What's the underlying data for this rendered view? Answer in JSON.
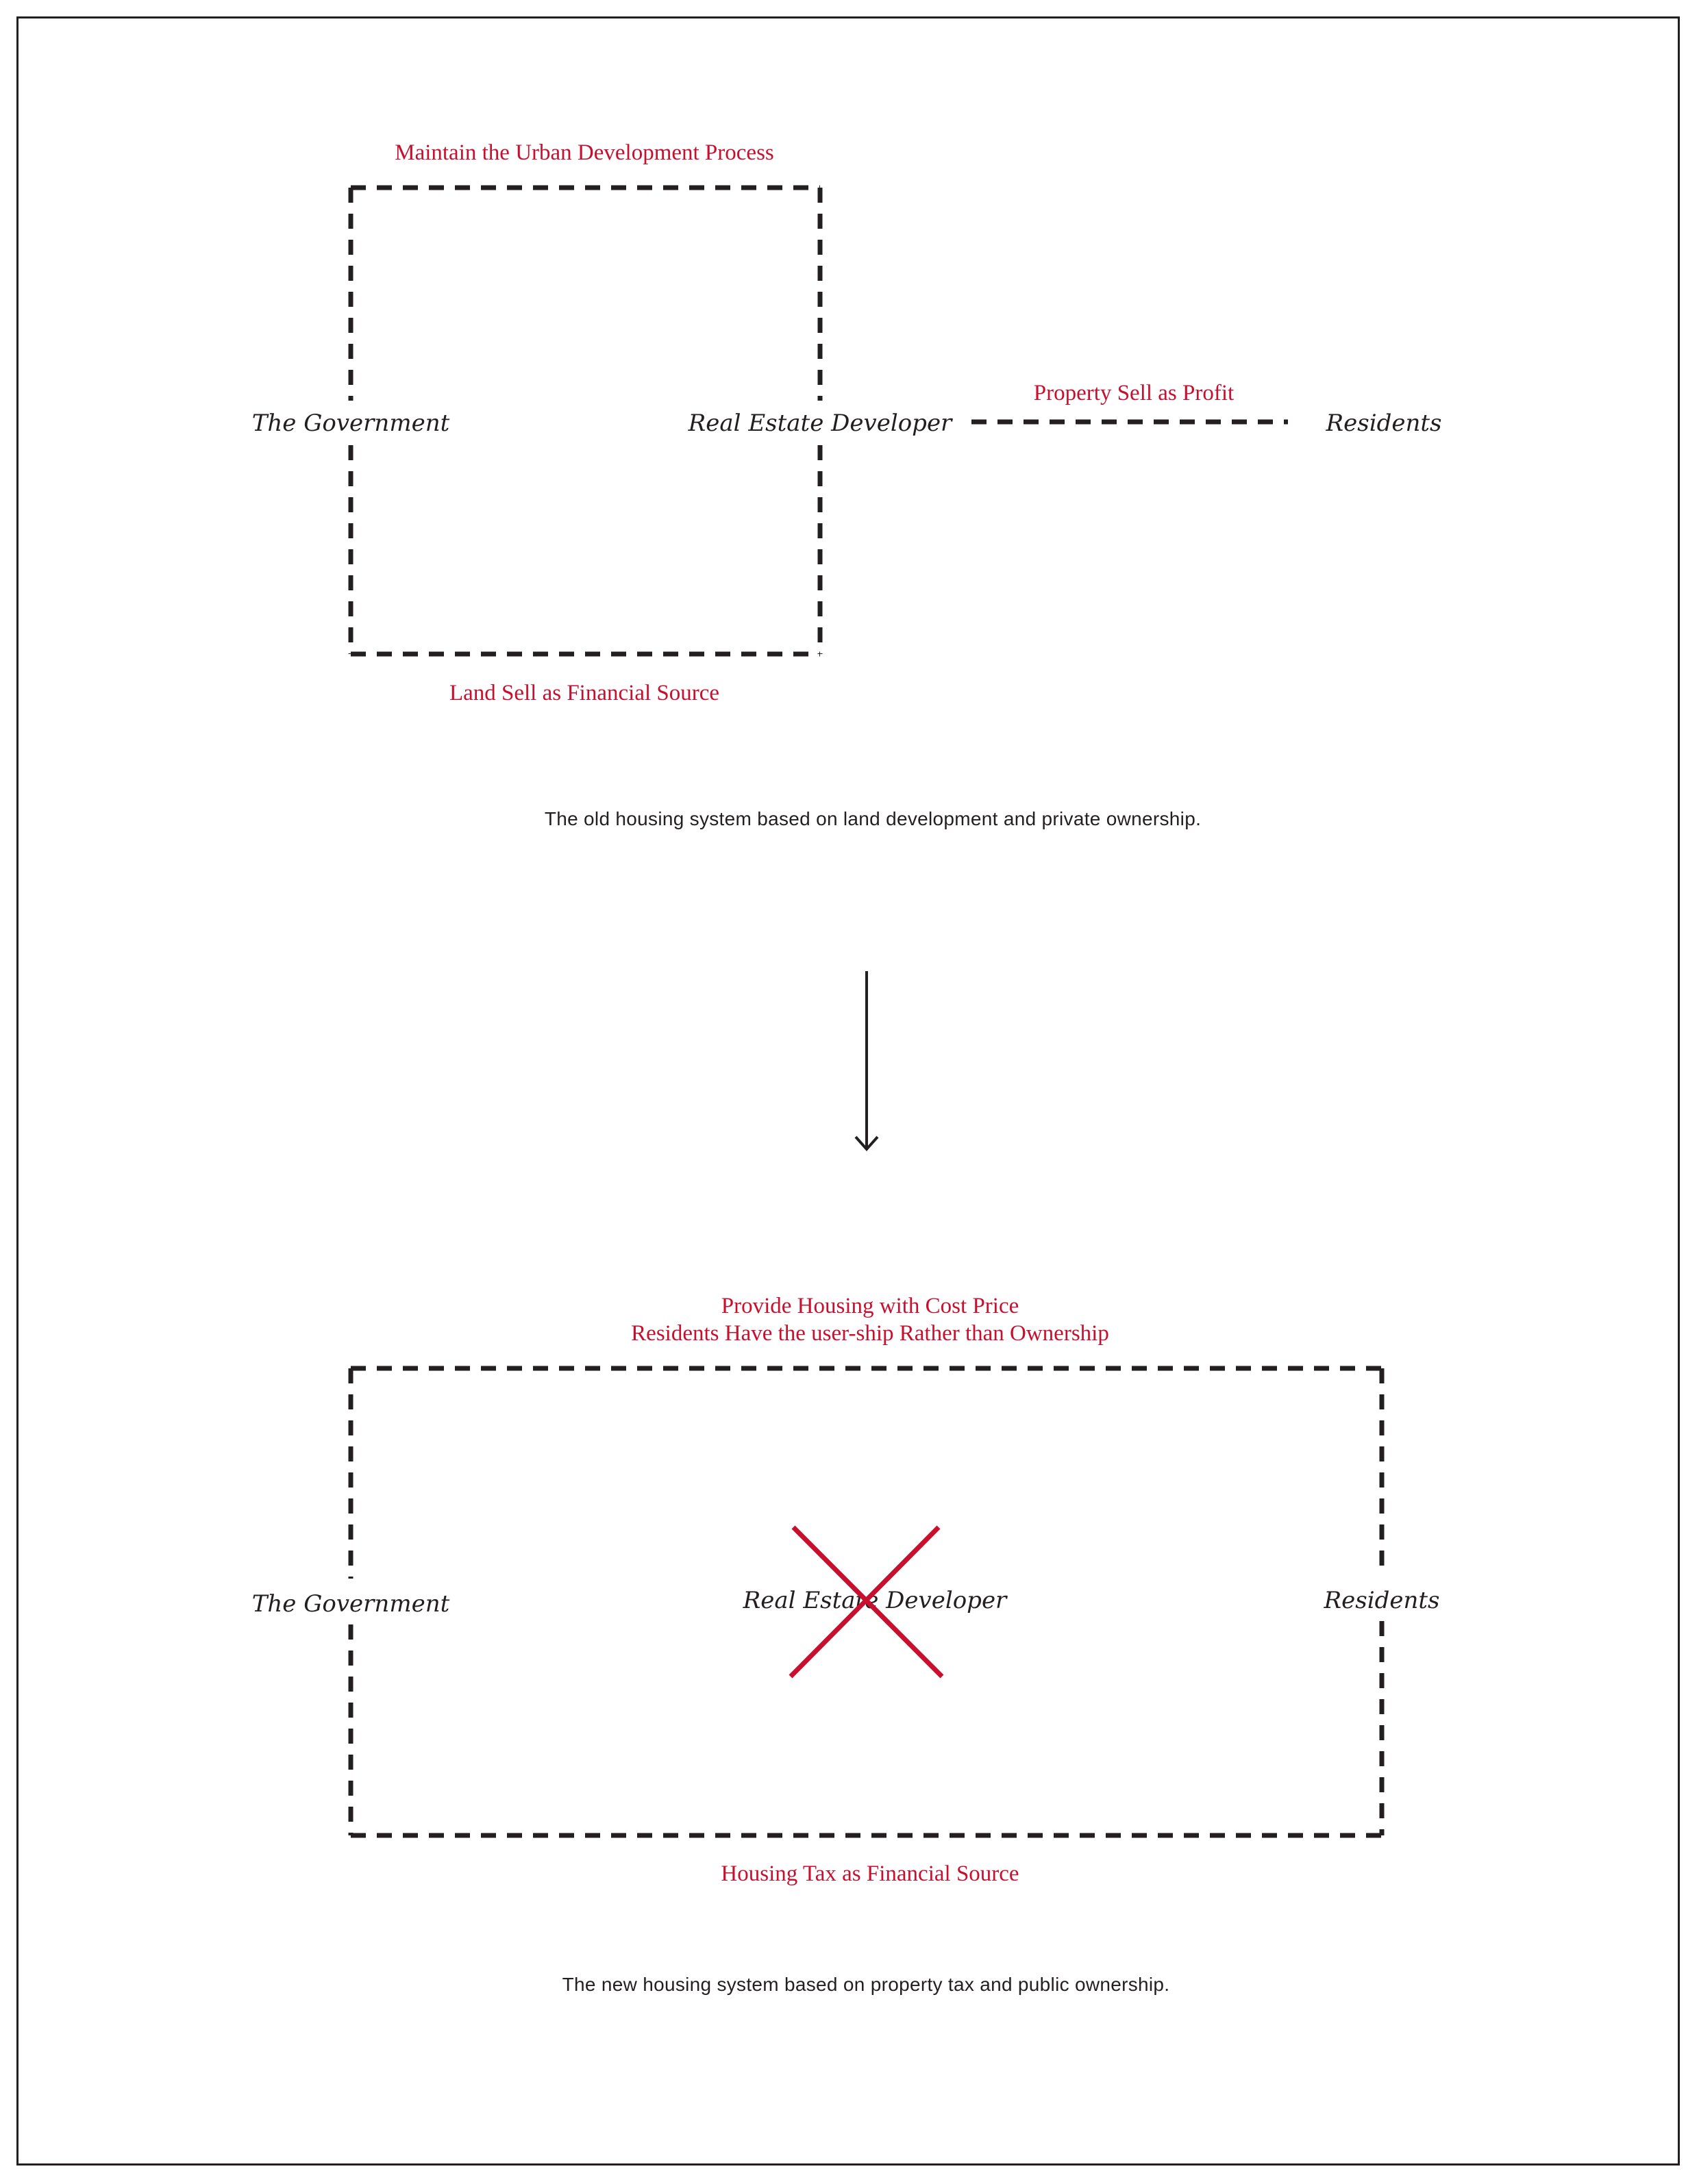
{
  "old_system": {
    "top_relation": "Maintain the Urban Development Process",
    "government": "The Government",
    "developer": "Real Estate Developer",
    "residents": "Residents",
    "developer_resident_relation": "Property Sell as Profit",
    "bottom_relation": "Land Sell as Financial Source",
    "caption": "The old housing system based on land development and private ownership."
  },
  "new_system": {
    "top_relation_line1": "Provide Housing with Cost Price",
    "top_relation_line2": "Residents Have the user-ship Rather than Ownership",
    "government": "The Government",
    "developer": "Real Estate Developer",
    "developer_status": "removed",
    "residents": "Residents",
    "bottom_relation": "Housing Tax as Financial Source",
    "caption": "The new housing system based on property tax and public ownership."
  },
  "colors": {
    "relation_text": "#c8102e",
    "cross_mark": "#c8102e",
    "entity_text": "#231f20",
    "lines": "#231f20"
  },
  "icons": {
    "transition": "down-arrow-icon",
    "removal": "cross-mark-icon"
  }
}
